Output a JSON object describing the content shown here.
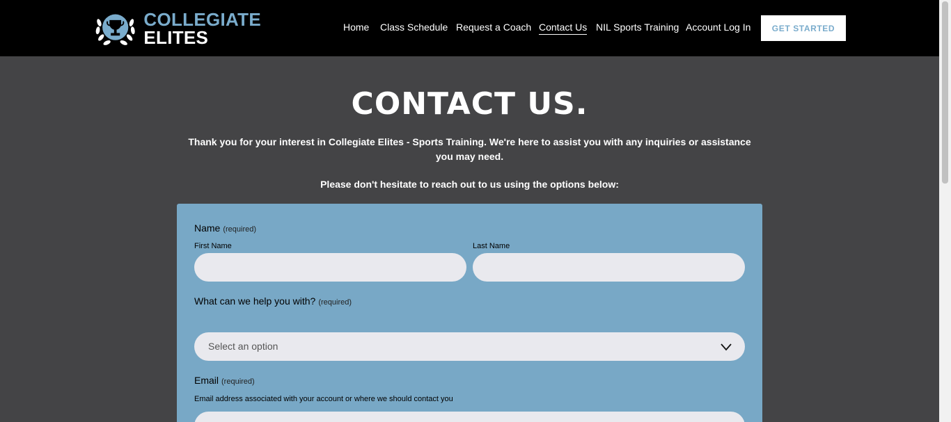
{
  "brand": {
    "line1": "COLLEGIATE",
    "line2": "ELITES",
    "accent": "#7aaccc"
  },
  "nav": {
    "items": [
      {
        "label": "Home",
        "active": false
      },
      {
        "label": "Class Schedule",
        "active": false
      },
      {
        "label": "Request a Coach",
        "active": false
      },
      {
        "label": "Contact Us",
        "active": true
      },
      {
        "label": "NIL Sports Training",
        "active": false
      },
      {
        "label": "Account Log In",
        "active": false
      }
    ],
    "cta_label": "GET STARTED"
  },
  "page": {
    "title": "CONTACT US.",
    "intro": "Thank you for your interest in Collegiate Elites - Sports Training. We're here to assist you with any inquiries or assistance you may need.",
    "intro2": "Please don't hesitate to reach out to us using the options below:"
  },
  "form": {
    "name_label": "Name",
    "required": "(required)",
    "first_name_label": "First Name",
    "last_name_label": "Last Name",
    "help_label": "What can we help you with?",
    "help_select_value": "Select an option",
    "email_label": "Email",
    "email_hint": "Email address associated with your account or where we should contact you"
  },
  "colors": {
    "background": "#444446",
    "form_bg": "#78a8c6",
    "input_bg": "#e9e9ee"
  }
}
